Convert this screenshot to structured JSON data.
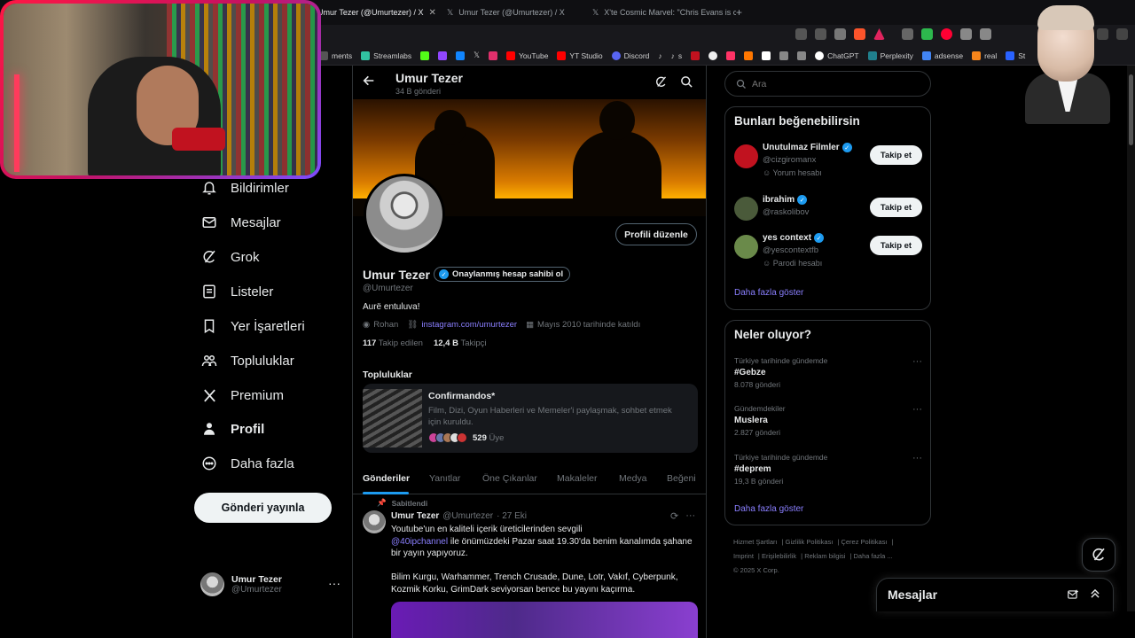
{
  "browser": {
    "tabs": [
      {
        "label": "Umur Tezer (@Umurtezer) / X",
        "active": true
      },
      {
        "label": "Umur Tezer (@Umurtezer) / X",
        "active": false
      },
      {
        "label": "X'te Cosmic Marvel: \"Chris Evans is c",
        "active": false
      }
    ],
    "bookmarks": [
      {
        "label": "ments",
        "color": "#666666"
      },
      {
        "label": "Streamlabs",
        "color": "#31c3a2"
      },
      {
        "label": "",
        "color": "#53fc18"
      },
      {
        "label": "",
        "color": "#9146ff"
      },
      {
        "label": "",
        "color": "#1185fe"
      },
      {
        "label": "",
        "color": "#ffffff"
      },
      {
        "label": "",
        "color": "#e1306c"
      },
      {
        "label": "YouTube",
        "color": "#ff0000"
      },
      {
        "label": "YT Studio",
        "color": "#ff0000"
      },
      {
        "label": "Discord",
        "color": "#5865f2"
      },
      {
        "label": "",
        "color": "#000000"
      },
      {
        "label": "s",
        "color": "#000000"
      },
      {
        "label": "",
        "color": "#c1121f"
      },
      {
        "label": "",
        "color": "#ff3366"
      },
      {
        "label": "",
        "color": "#ff7700"
      },
      {
        "label": "",
        "color": "#ffffff"
      },
      {
        "label": "",
        "color": "#888888"
      },
      {
        "label": "ChatGPT",
        "color": "#ffffff"
      },
      {
        "label": "Perplexity",
        "color": "#20808d"
      },
      {
        "label": "adsense",
        "color": "#4285f4"
      },
      {
        "label": "real",
        "color": "#f6851b"
      },
      {
        "label": "St",
        "color": "#2962ff"
      }
    ]
  },
  "nav": {
    "items": [
      {
        "label": "Bildirimler",
        "icon": "bell-icon"
      },
      {
        "label": "Mesajlar",
        "icon": "mail-icon"
      },
      {
        "label": "Grok",
        "icon": "grok-icon"
      },
      {
        "label": "Listeler",
        "icon": "list-icon"
      },
      {
        "label": "Yer İşaretleri",
        "icon": "bookmark-icon"
      },
      {
        "label": "Topluluklar",
        "icon": "communities-icon"
      },
      {
        "label": "Premium",
        "icon": "x-logo-icon"
      },
      {
        "label": "Profil",
        "icon": "person-icon"
      },
      {
        "label": "Daha fazla",
        "icon": "more-circle-icon"
      }
    ],
    "post_button": "Gönderi yayınla",
    "account": {
      "name": "Umur Tezer",
      "handle": "@Umurtezer",
      "more": "···"
    }
  },
  "profile": {
    "header_title": "Umur Tezer",
    "header_sub": "34 B gönderi",
    "edit_button": "Profili düzenle",
    "name": "Umur Tezer",
    "verified_label": "Onaylanmış hesap sahibi ol",
    "handle": "@Umurtezer",
    "bio": "Aurë entuluva!",
    "location": "Rohan",
    "link": "instagram.com/umurtezer",
    "joined": "Mayıs 2010 tarihinde katıldı",
    "following_count": "117",
    "following_label": "Takip edilen",
    "followers_count": "12,4 B",
    "followers_label": "Takipçi"
  },
  "communities": {
    "title": "Topluluklar",
    "name": "Confirmandos*",
    "description": "Film, Dizi, Oyun Haberleri ve Memeler'i paylaşmak, sohbet etmek için kuruldu.",
    "members_count": "529",
    "members_label": "Üye"
  },
  "tabs": [
    "Gönderiler",
    "Yanıtlar",
    "Öne Çıkanlar",
    "Makaleler",
    "Medya",
    "Beğeni"
  ],
  "pinned_tweet": {
    "pinned_label": "Sabitlendi",
    "name": "Umur Tezer",
    "handle": "@Umurtezer",
    "date": "· 27 Eki",
    "text1": "Youtube'un en kaliteli içerik üreticilerinden sevgili",
    "mention": "@40ipchannel",
    "text2": " ile önümüzdeki Pazar saat 19.30'da benim kanalımda şahane bir yayın yapıyoruz.",
    "text3": "Bilim Kurgu, Warhammer, Trench Crusade, Dune, Lotr, Vakıf, Cyberpunk, Kozmik Korku, GrimDark seviyorsan bence bu yayını kaçırma."
  },
  "search": {
    "placeholder": "Ara"
  },
  "suggestions": {
    "title": "Bunları beğenebilirsin",
    "items": [
      {
        "name": "Unutulmaz Filmler",
        "handle": "@cizgiromanx",
        "label": "Yorum hesabı",
        "button": "Takip et",
        "color": "#c1121f"
      },
      {
        "name": "ibrahim",
        "handle": "@raskolibov",
        "label": "",
        "button": "Takip et",
        "color": "#4a5a3a"
      },
      {
        "name": "yes context",
        "handle": "@yescontextfb",
        "label": "Parodi hesabı",
        "button": "Takip et",
        "color": "#6a8a4a"
      }
    ],
    "show_more": "Daha fazla göster"
  },
  "trends": {
    "title": "Neler oluyor?",
    "items": [
      {
        "context": "Türkiye tarihinde gündemde",
        "tag": "#Gebze",
        "count": "8.078 gönderi"
      },
      {
        "context": "Gündemdekiler",
        "tag": "Muslera",
        "count": "2.827 gönderi"
      },
      {
        "context": "Türkiye tarihinde gündemde",
        "tag": "#deprem",
        "count": "19,3 B gönderi"
      }
    ],
    "show_more": "Daha fazla göster"
  },
  "footer": {
    "links": [
      "Hizmet Şartları",
      "Gizlilik Politikası",
      "Çerez Politikası",
      "Imprint",
      "Erişilebilirlik",
      "Reklam bilgisi",
      "Daha fazla ...",
      "© 2025 X Corp."
    ]
  },
  "dm_bar": {
    "title": "Mesajlar"
  },
  "colors": {
    "accent": "#1d9bf0",
    "link": "#8a7fff",
    "background": "#000000"
  }
}
